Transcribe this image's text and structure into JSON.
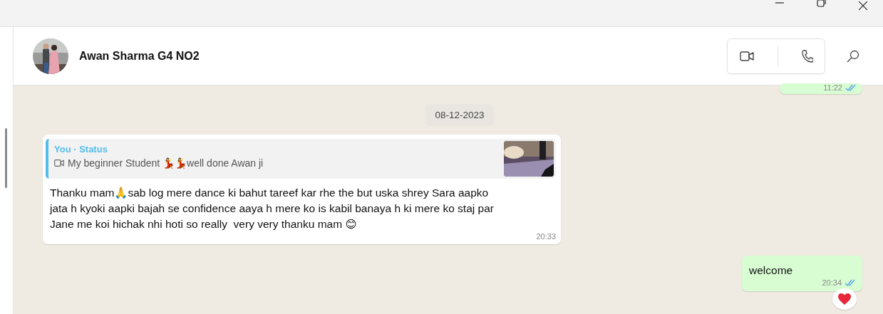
{
  "contact": {
    "name": "Awan Sharma G4 NO2"
  },
  "messages": [
    {
      "kind": "outgoing",
      "time": "11:22",
      "read": true
    },
    {
      "kind": "date",
      "text": "08-12-2023"
    },
    {
      "kind": "incoming",
      "quote": {
        "author": "You · Status",
        "video": true,
        "text": "My beginner Student 💃💃well done Awan ji"
      },
      "text": "Thanku mam🙏sab log mere dance ki bahut tareef kar rhe the but uska shrey Sara aapko\njata h kyoki aapki bajah se confidence aaya h mere ko is kabil banaya h ki mere ko staj par\nJane me koi hichak nhi hoti so really  very very thanku mam 😊",
      "time": "20:33"
    },
    {
      "kind": "outgoing",
      "text": "welcome",
      "time": "20:34",
      "read": true,
      "heart_reaction": true
    }
  ]
}
